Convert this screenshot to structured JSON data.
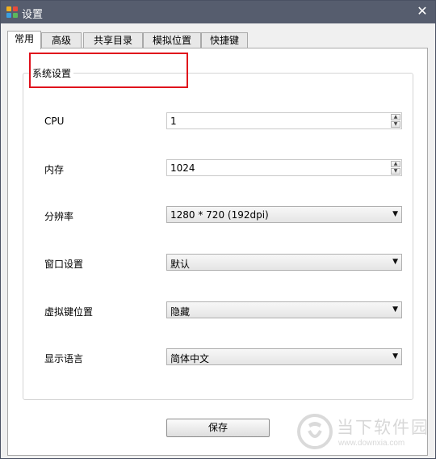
{
  "window": {
    "title": "设置",
    "close_glyph": "✕"
  },
  "tabs": [
    {
      "label": "常用",
      "active": true
    },
    {
      "label": "高级",
      "active": false
    },
    {
      "label": "共享目录",
      "active": false
    },
    {
      "label": "模拟位置",
      "active": false
    },
    {
      "label": "快捷键",
      "active": false
    }
  ],
  "group": {
    "title": "系统设置",
    "rows": [
      {
        "label": "CPU",
        "value": "1",
        "control": "spinbox"
      },
      {
        "label": "内存",
        "value": "1024",
        "control": "spinbox"
      },
      {
        "label": "分辨率",
        "value": "1280 * 720 (192dpi)",
        "control": "dropdown"
      },
      {
        "label": "窗口设置",
        "value": "默认",
        "control": "dropdown"
      },
      {
        "label": "虚拟键位置",
        "value": "隐藏",
        "control": "dropdown"
      },
      {
        "label": "显示语言",
        "value": "简体中文",
        "control": "dropdown"
      }
    ]
  },
  "save_button": {
    "label": "保存"
  },
  "watermark": {
    "text": "当下软件园",
    "url": "www.downxia.com"
  },
  "colors": {
    "titlebar": "#565d6e",
    "highlight_border": "#e0101c",
    "panel_border": "#a9a9a9"
  },
  "icons": {
    "app": "colorful-grid-icon",
    "spin_up": "spin-up-icon",
    "spin_down": "spin-down-icon",
    "caret": "caret-down-icon"
  }
}
